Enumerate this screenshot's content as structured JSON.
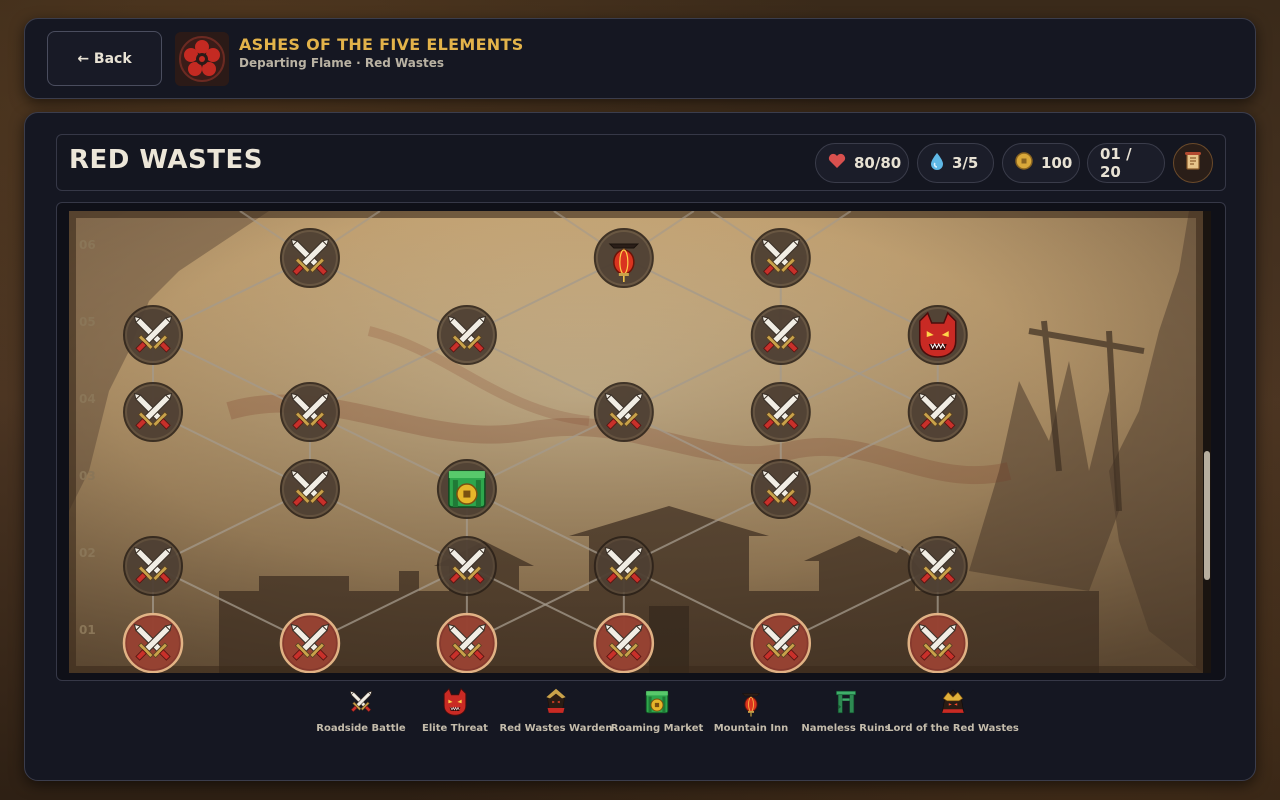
{
  "header": {
    "back_label": "← Back",
    "game_title": "ASHES OF THE FIVE ELEMENTS",
    "subtitle": "Departing Flame · Red Wastes"
  },
  "region": {
    "title": "RED WASTES"
  },
  "stats": {
    "health": "80/80",
    "water": "3/5",
    "coins": "100",
    "progress": "01 / 20"
  },
  "map": {
    "rows": [
      "06",
      "05",
      "04",
      "03",
      "02",
      "01"
    ],
    "nodes": [
      {
        "row": "06",
        "col": 2,
        "type": "battle"
      },
      {
        "row": "06",
        "col": 4,
        "type": "inn"
      },
      {
        "row": "06",
        "col": 5,
        "type": "battle"
      },
      {
        "row": "05",
        "col": 1,
        "type": "battle"
      },
      {
        "row": "05",
        "col": 3,
        "type": "battle"
      },
      {
        "row": "05",
        "col": 5,
        "type": "battle"
      },
      {
        "row": "05",
        "col": 6,
        "type": "elite"
      },
      {
        "row": "04",
        "col": 1,
        "type": "battle"
      },
      {
        "row": "04",
        "col": 2,
        "type": "battle"
      },
      {
        "row": "04",
        "col": 4,
        "type": "battle"
      },
      {
        "row": "04",
        "col": 5,
        "type": "battle"
      },
      {
        "row": "04",
        "col": 6,
        "type": "battle"
      },
      {
        "row": "03",
        "col": 2,
        "type": "battle"
      },
      {
        "row": "03",
        "col": 3,
        "type": "market"
      },
      {
        "row": "03",
        "col": 5,
        "type": "battle"
      },
      {
        "row": "02",
        "col": 1,
        "type": "battle"
      },
      {
        "row": "02",
        "col": 3,
        "type": "battle"
      },
      {
        "row": "02",
        "col": 4,
        "type": "battle"
      },
      {
        "row": "02",
        "col": 6,
        "type": "battle"
      },
      {
        "row": "01",
        "col": 1,
        "type": "battle",
        "available": true
      },
      {
        "row": "01",
        "col": 2,
        "type": "battle",
        "available": true
      },
      {
        "row": "01",
        "col": 3,
        "type": "battle",
        "available": true
      },
      {
        "row": "01",
        "col": 4,
        "type": "battle",
        "available": true
      },
      {
        "row": "01",
        "col": 5,
        "type": "battle",
        "available": true
      },
      {
        "row": "01",
        "col": 6,
        "type": "battle",
        "available": true
      }
    ],
    "scroll_position": 0.72,
    "scroll_visible_fraction": 0.28
  },
  "legend": [
    {
      "type": "battle",
      "label": "Roadside Battle"
    },
    {
      "type": "elite",
      "label": "Elite Threat"
    },
    {
      "type": "warden",
      "label": "Red Wastes Warden"
    },
    {
      "type": "market",
      "label": "Roaming Market"
    },
    {
      "type": "inn",
      "label": "Mountain Inn"
    },
    {
      "type": "ruins",
      "label": "Nameless Ruins"
    },
    {
      "type": "lord",
      "label": "Lord of the Red Wastes"
    }
  ],
  "colors": {
    "accent_gold": "#e3b34a",
    "available_node": "#8a3a2e",
    "panel": "#151722"
  }
}
